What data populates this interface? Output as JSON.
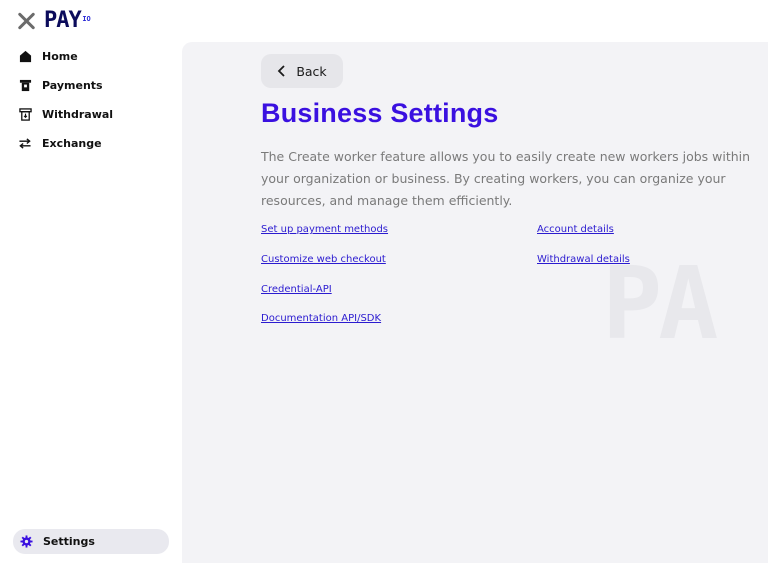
{
  "logo": {
    "text": "PAY",
    "suffix": "IO"
  },
  "nav": {
    "items": [
      {
        "label": "Home",
        "icon": "home-icon"
      },
      {
        "label": "Payments",
        "icon": "payments-icon"
      },
      {
        "label": "Withdrawal",
        "icon": "withdrawal-icon"
      },
      {
        "label": "Exchange",
        "icon": "exchange-icon"
      }
    ],
    "settings": {
      "label": "Settings",
      "icon": "gear-icon"
    }
  },
  "main": {
    "back_label": "Back",
    "title": "Business Settings",
    "description": "The Create worker feature allows you to easily create new workers jobs within your organization or business. By creating workers, you can organize your resources, and manage them efficiently.",
    "links_left": [
      "Set up payment methods",
      "Customize web checkout",
      "Credential-API",
      "Documentation API/SDK"
    ],
    "links_right": [
      "Account details",
      "Withdrawal details"
    ],
    "watermark": "PA"
  },
  "colors": {
    "accent": "#3a10e0",
    "link": "#2b1bd0",
    "main_bg": "#f3f3f6",
    "active_nav_bg": "#e9e9ef"
  }
}
